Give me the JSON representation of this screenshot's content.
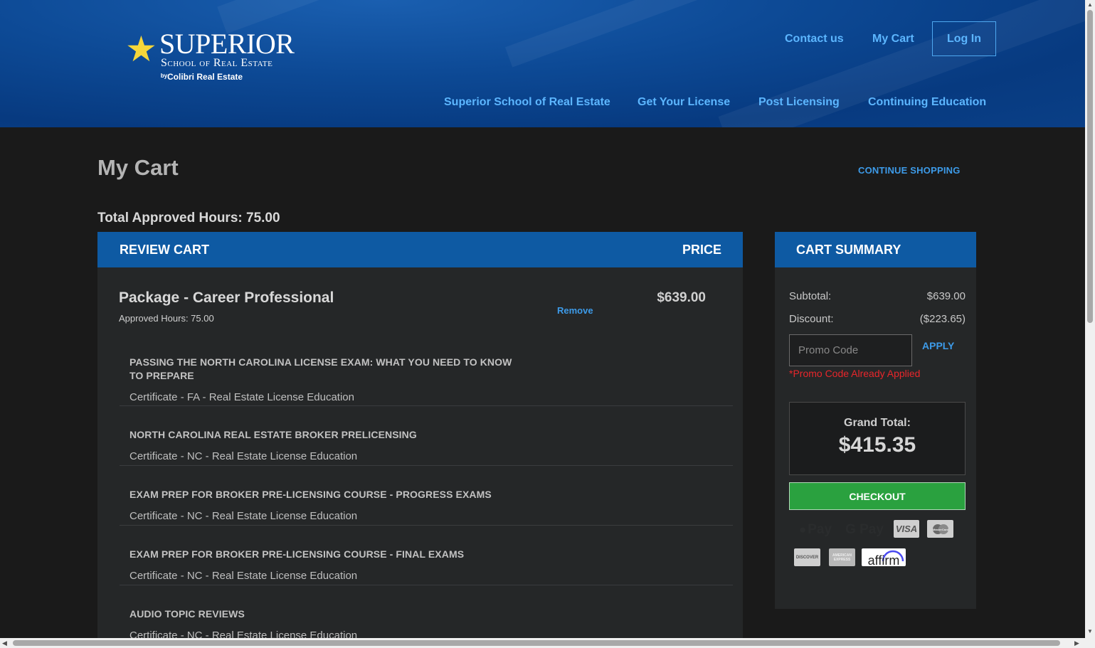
{
  "header": {
    "logo": {
      "name": "SUPERIOR",
      "sub": "School of Real Estate",
      "by": "ᵇʸColibri Real Estate"
    },
    "top_links": {
      "contact": "Contact us",
      "cart": "My Cart",
      "login": "Log In"
    },
    "nav": [
      "Superior School of Real Estate",
      "Get Your License",
      "Post Licensing",
      "Continuing Education"
    ]
  },
  "page": {
    "title": "My Cart",
    "continue_shopping": "CONTINUE SHOPPING",
    "approved_hours": "Total Approved Hours: 75.00"
  },
  "review_cart": {
    "header": "REVIEW CART",
    "price_header": "PRICE",
    "package": {
      "title": "Package - Career Professional",
      "hours": "Approved Hours: 75.00",
      "remove": "Remove",
      "price": "$639.00"
    },
    "courses": [
      {
        "title": "PASSING THE NORTH CAROLINA LICENSE EXAM: WHAT YOU NEED TO KNOW TO PREPARE",
        "subtitle": "Certificate - FA - Real Estate License Education"
      },
      {
        "title": "NORTH CAROLINA REAL ESTATE BROKER PRELICENSING",
        "subtitle": "Certificate - NC - Real Estate License Education"
      },
      {
        "title": "EXAM PREP FOR BROKER PRE-LICENSING COURSE - PROGRESS EXAMS",
        "subtitle": "Certificate - NC - Real Estate License Education"
      },
      {
        "title": "EXAM PREP FOR BROKER PRE-LICENSING COURSE - FINAL EXAMS",
        "subtitle": "Certificate - NC - Real Estate License Education"
      },
      {
        "title": "AUDIO TOPIC REVIEWS",
        "subtitle": "Certificate - NC - Real Estate License Education"
      }
    ]
  },
  "summary": {
    "header": "CART SUMMARY",
    "subtotal_label": "Subtotal:",
    "subtotal_value": "$639.00",
    "discount_label": "Discount:",
    "discount_value": "($223.65)",
    "promo_placeholder": "Promo Code",
    "apply": "APPLY",
    "promo_note": "*Promo Code Already Applied",
    "grand_label": "Grand Total:",
    "grand_value": "$415.35",
    "checkout": "CHECKOUT",
    "payment_icons": [
      "apple-pay",
      "google-pay",
      "visa",
      "mastercard",
      "discover",
      "american-express",
      "affirm"
    ],
    "payment_labels": {
      "apple": "Pay",
      "google": "G Pay",
      "visa": "VISA",
      "mc": "MasterCard",
      "discover": "DISCOVER",
      "amex": "AMERICAN EXPRESS",
      "affirm": "affirm"
    }
  },
  "colors": {
    "accent": "#0e5aa3",
    "link": "#3d9be9",
    "checkout": "#2aa13f",
    "error": "#e8262b"
  }
}
